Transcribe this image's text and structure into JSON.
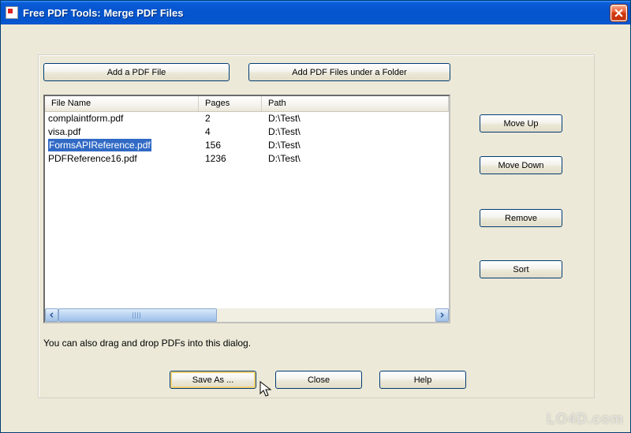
{
  "window": {
    "title": "Free PDF Tools: Merge PDF Files"
  },
  "buttons": {
    "add_file": "Add a PDF File",
    "add_folder": "Add PDF Files under a Folder",
    "move_up": "Move Up",
    "move_down": "Move Down",
    "remove": "Remove",
    "sort": "Sort",
    "save_as": "Save As ...",
    "close": "Close",
    "help": "Help"
  },
  "list": {
    "columns": {
      "name": "File Name",
      "pages": "Pages",
      "path": "Path"
    },
    "rows": [
      {
        "name": "complaintform.pdf",
        "pages": "2",
        "path": "D:\\Test\\",
        "selected": false
      },
      {
        "name": "visa.pdf",
        "pages": "4",
        "path": "D:\\Test\\",
        "selected": false
      },
      {
        "name": "FormsAPIReference.pdf",
        "pages": "156",
        "path": "D:\\Test\\",
        "selected": true
      },
      {
        "name": "PDFReference16.pdf",
        "pages": "1236",
        "path": "D:\\Test\\",
        "selected": false
      }
    ]
  },
  "hint": "You can also drag and drop PDFs into this dialog.",
  "watermark": "LO4D.com"
}
